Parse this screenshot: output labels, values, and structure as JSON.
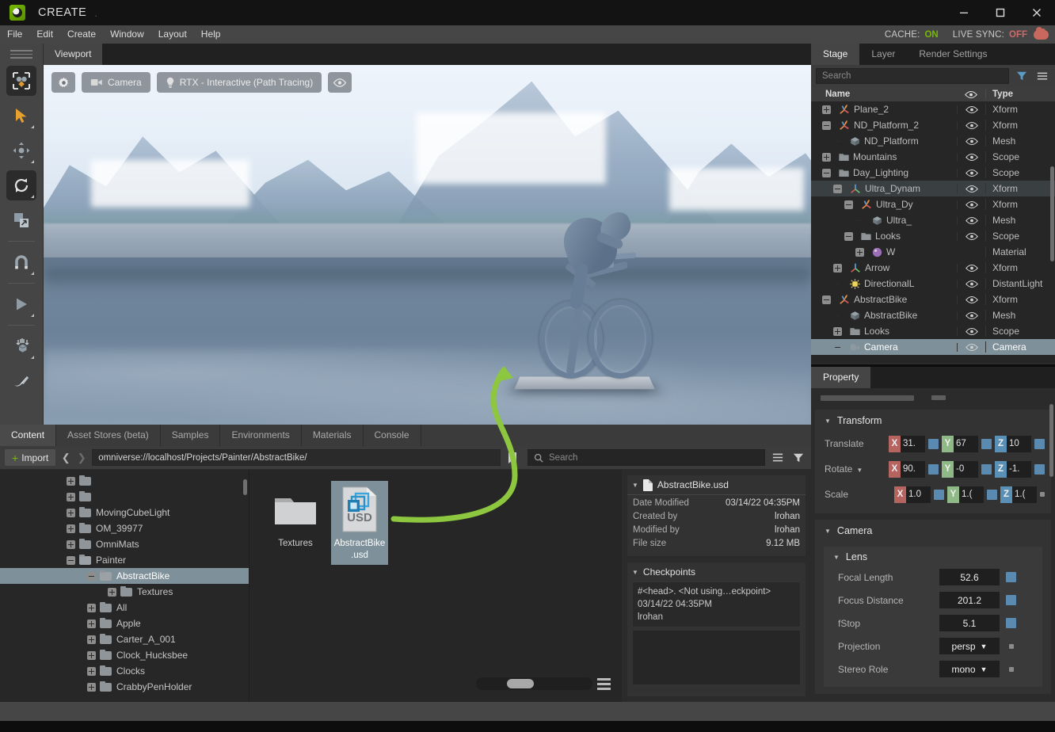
{
  "window": {
    "title": "CREATE",
    "title_suffix": ".",
    "logo_icon": "omniverse-logo-icon",
    "minimize_icon": "minimize-icon",
    "maximize_icon": "maximize-icon",
    "close_icon": "close-icon"
  },
  "menubar": {
    "items": [
      "File",
      "Edit",
      "Create",
      "Window",
      "Layout",
      "Help"
    ],
    "cache_label": "CACHE:",
    "cache_value": "ON",
    "livesync_label": "LIVE SYNC:",
    "livesync_value": "OFF",
    "cloud_icon": "cloud-icon",
    "colors": {
      "on": "#76b900",
      "off": "#d06a6a"
    }
  },
  "left_toolbar": {
    "items": [
      {
        "name": "select-mode-tool",
        "icon": "selection-box-icon",
        "active": true
      },
      {
        "name": "select-tool",
        "icon": "arrow-cursor-icon",
        "active": false
      },
      {
        "name": "move-tool",
        "icon": "move-arrows-icon",
        "active": false
      },
      {
        "name": "rotate-tool",
        "icon": "rotate-arrows-icon",
        "active": true
      },
      {
        "name": "scale-tool",
        "icon": "scale-square-icon",
        "active": false
      },
      {
        "name": "snap-tool",
        "icon": "magnet-icon",
        "active": false
      },
      {
        "name": "play-tool",
        "icon": "play-triangle-icon",
        "active": false
      },
      {
        "name": "physics-drop-tool",
        "icon": "drop-object-icon",
        "active": false
      },
      {
        "name": "paint-tool",
        "icon": "paintbrush-icon",
        "active": false
      }
    ]
  },
  "viewport": {
    "tab_label": "Viewport",
    "toolbar": [
      {
        "name": "viewport-settings-button",
        "icon": "gear-icon",
        "label": ""
      },
      {
        "name": "camera-button",
        "icon": "camera-icon",
        "label": "Camera"
      },
      {
        "name": "renderer-button",
        "icon": "lightbulb-icon",
        "label": "RTX - Interactive (Path Tracing)"
      },
      {
        "name": "visibility-button",
        "icon": "eye-icon",
        "label": ""
      }
    ],
    "scene_description": "Blue metallic abstract cyclist sculpture on a plinth over reflective water with snow mountains"
  },
  "annotation": {
    "arrow_color": "#8dc63f",
    "description": "green curved arrow from AbstractBike.usd asset to the viewport statue"
  },
  "content_browser": {
    "tabs": [
      {
        "label": "Content",
        "active": true
      },
      {
        "label": "Asset Stores (beta)",
        "active": false
      },
      {
        "label": "Samples",
        "active": false
      },
      {
        "label": "Environments",
        "active": false
      },
      {
        "label": "Materials",
        "active": false
      },
      {
        "label": "Console",
        "active": false
      }
    ],
    "import_label": "Import",
    "back_icon": "chevron-left-icon",
    "forward_icon": "chevron-right-icon",
    "path": "omniverse://localhost/Projects/Painter/AbstractBike/",
    "bookmark_icon": "bookmark-icon",
    "search_icon": "search-icon",
    "search_placeholder": "Search",
    "list_icon": "list-view-icon",
    "filter_icon": "filter-icon",
    "tree": [
      {
        "label": "",
        "indent": 1,
        "state": "plus"
      },
      {
        "label": "",
        "indent": 1,
        "state": "plus"
      },
      {
        "label": "MovingCubeLight",
        "indent": 1,
        "state": "plus"
      },
      {
        "label": "OM_39977",
        "indent": 1,
        "state": "plus"
      },
      {
        "label": "OmniMats",
        "indent": 1,
        "state": "plus"
      },
      {
        "label": "Painter",
        "indent": 1,
        "state": "minus",
        "open": true
      },
      {
        "label": "AbstractBike",
        "indent": 2,
        "state": "minus",
        "open": true,
        "selected": true
      },
      {
        "label": "Textures",
        "indent": 3,
        "state": "plus"
      },
      {
        "label": "All",
        "indent": 2,
        "state": "plus"
      },
      {
        "label": "Apple",
        "indent": 2,
        "state": "plus"
      },
      {
        "label": "Carter_A_001",
        "indent": 2,
        "state": "plus"
      },
      {
        "label": "Clock_Hucksbee",
        "indent": 2,
        "state": "plus"
      },
      {
        "label": "Clocks",
        "indent": 2,
        "state": "plus"
      },
      {
        "label": "CrabbyPenHolder",
        "indent": 2,
        "state": "plus"
      }
    ],
    "assets": [
      {
        "label": "Textures",
        "icon": "folder-icon",
        "selected": false
      },
      {
        "label": "AbstractBike.usd",
        "caption_line1": "AbstractBike",
        "caption_line2": ".usd",
        "icon": "usd-file-icon",
        "selected": true
      }
    ],
    "zoom_slider_value": 30,
    "detail": {
      "file_name": "AbstractBike.usd",
      "file_icon": "document-icon",
      "meta": [
        {
          "key": "Date Modified",
          "value": "03/14/22 04:35PM"
        },
        {
          "key": "Created by",
          "value": "lrohan"
        },
        {
          "key": "Modified by",
          "value": "lrohan"
        },
        {
          "key": "File size",
          "value": "9.12 MB"
        }
      ],
      "checkpoints_label": "Checkpoints",
      "checkpoint": {
        "line1": "#<head>.  <Not using…eckpoint>",
        "line2": "03/14/22 04:35PM",
        "line3": "lrohan"
      }
    }
  },
  "stage": {
    "tabs": [
      {
        "label": "Stage",
        "active": true
      },
      {
        "label": "Layer",
        "active": false
      },
      {
        "label": "Render Settings",
        "active": false
      }
    ],
    "search_placeholder": "Search",
    "filter_icon": "filter-icon",
    "menu_icon": "hamburger-menu-icon",
    "columns": {
      "name": "Name",
      "eye": "eye-icon",
      "type": "Type"
    },
    "rows": [
      {
        "name": "Plane_2",
        "type": "Xform",
        "indent": 1,
        "state": "plus",
        "icon": "xform-axis-orange-icon"
      },
      {
        "name": "ND_Platform_2",
        "type": "Xform",
        "indent": 1,
        "state": "minus",
        "icon": "xform-axis-orange-icon"
      },
      {
        "name": "ND_Platform",
        "type": "Mesh",
        "indent": 2,
        "state": "none",
        "icon": "mesh-cube-icon"
      },
      {
        "name": "Mountains",
        "type": "Scope",
        "indent": 1,
        "state": "plus",
        "icon": "folder-icon"
      },
      {
        "name": "Day_Lighting",
        "type": "Scope",
        "indent": 1,
        "state": "minus",
        "icon": "folder-icon"
      },
      {
        "name": "Ultra_Dynam",
        "type": "Xform",
        "indent": 2,
        "state": "minus",
        "icon": "xform-axis-icon",
        "highlight": true
      },
      {
        "name": "Ultra_Dy",
        "type": "Xform",
        "indent": 3,
        "state": "minus",
        "icon": "xform-axis-orange-icon"
      },
      {
        "name": "Ultra_",
        "type": "Mesh",
        "indent": 4,
        "state": "none",
        "icon": "mesh-cube-icon"
      },
      {
        "name": "Looks",
        "type": "Scope",
        "indent": 3,
        "state": "minus",
        "icon": "folder-icon"
      },
      {
        "name": "W",
        "type": "Material",
        "indent": 4,
        "state": "plus",
        "icon": "material-sphere-icon",
        "no_eye": true
      },
      {
        "name": "Arrow",
        "type": "Xform",
        "indent": 2,
        "state": "plus",
        "icon": "xform-axis-icon"
      },
      {
        "name": "DirectionalL",
        "type": "DistantLight",
        "indent": 2,
        "state": "none",
        "icon": "distant-light-icon"
      },
      {
        "name": "AbstractBike",
        "type": "Xform",
        "indent": 1,
        "state": "minus",
        "icon": "xform-axis-orange-icon"
      },
      {
        "name": "AbstractBike",
        "type": "Mesh",
        "indent": 2,
        "state": "none",
        "icon": "mesh-cube-icon"
      },
      {
        "name": "Looks",
        "type": "Scope",
        "indent": 2,
        "state": "plus",
        "icon": "folder-icon"
      },
      {
        "name": "Camera",
        "type": "Camera",
        "indent": 2,
        "state": "none",
        "icon": "camera-icon",
        "selected": true
      }
    ]
  },
  "property": {
    "tab_label": "Property",
    "transform": {
      "title": "Transform",
      "rows": [
        {
          "label": "Translate",
          "dropdown": false,
          "axes": [
            {
              "axis": "X",
              "value": "31."
            },
            {
              "axis": "Y",
              "value": "67"
            },
            {
              "axis": "Z",
              "value": "10"
            }
          ]
        },
        {
          "label": "Rotate",
          "dropdown": true,
          "axes": [
            {
              "axis": "X",
              "value": "90."
            },
            {
              "axis": "Y",
              "value": "-0"
            },
            {
              "axis": "Z",
              "value": "-1."
            }
          ]
        },
        {
          "label": "Scale",
          "dropdown": false,
          "axes": [
            {
              "axis": "X",
              "value": "1.0"
            },
            {
              "axis": "Y",
              "value": "1.("
            },
            {
              "axis": "Z",
              "value": "1.("
            }
          ]
        }
      ]
    },
    "camera": {
      "title": "Camera",
      "lens_title": "Lens",
      "fields": [
        {
          "label": "Focal Length",
          "value": "52.6",
          "kind": "number"
        },
        {
          "label": "Focus Distance",
          "value": "201.2",
          "kind": "number"
        },
        {
          "label": "fStop",
          "value": "5.1",
          "kind": "number"
        },
        {
          "label": "Projection",
          "value": "persp",
          "kind": "select"
        },
        {
          "label": "Stereo Role",
          "value": "mono",
          "kind": "select"
        }
      ]
    },
    "accent_blue": "#5a8ab0"
  }
}
